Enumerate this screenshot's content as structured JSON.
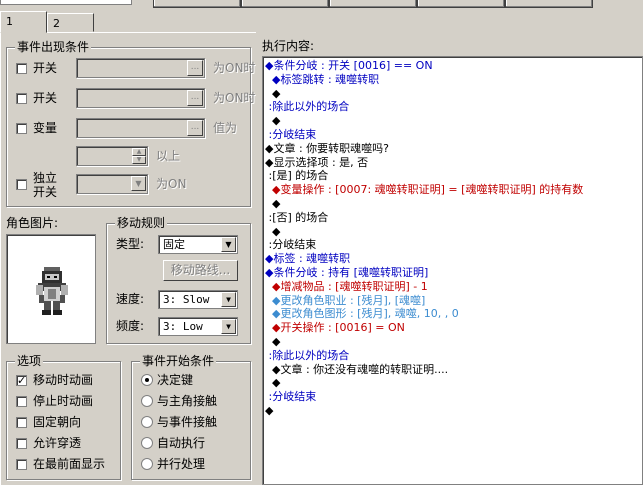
{
  "tabs": [
    "1",
    "2"
  ],
  "conditions": {
    "title": "事件出现条件",
    "switch1": {
      "label": "开关",
      "suffix": "为ON时"
    },
    "switch2": {
      "label": "开关",
      "suffix": "为ON时"
    },
    "variable": {
      "label": "变量",
      "suffix": "值为",
      "suffix2": "以上"
    },
    "self_switch": {
      "label_line1": "独立",
      "label_line2": "开关",
      "suffix": "为ON"
    }
  },
  "graphic": {
    "title": "角色图片:"
  },
  "movement": {
    "title": "移动规则",
    "type_label": "类型:",
    "type_value": "固定",
    "route_button": "移动路线...",
    "speed_label": "速度:",
    "speed_value": "3: Slow",
    "freq_label": "频度:",
    "freq_value": "3: Low"
  },
  "options": {
    "title": "选项",
    "items": [
      {
        "label": "移动时动画",
        "checked": true
      },
      {
        "label": "停止时动画",
        "checked": false
      },
      {
        "label": "固定朝向",
        "checked": false
      },
      {
        "label": "允许穿透",
        "checked": false
      },
      {
        "label": "在最前面显示",
        "checked": false
      }
    ]
  },
  "trigger": {
    "title": "事件开始条件",
    "items": [
      {
        "label": "决定键",
        "selected": true
      },
      {
        "label": "与主角接触",
        "selected": false
      },
      {
        "label": "与事件接触",
        "selected": false
      },
      {
        "label": "自动执行",
        "selected": false
      },
      {
        "label": "并行处理",
        "selected": false
      }
    ]
  },
  "contents": {
    "title": "执行内容:",
    "lines": [
      {
        "indent": "",
        "text": "◆条件分岐 : 开关 [0016] == ON",
        "color": "#0000c0"
      },
      {
        "indent": "  ",
        "text": "◆标签跳转 : 魂噬转职",
        "color": "#0000c0"
      },
      {
        "indent": "  ",
        "text": "◆",
        "color": "#000000"
      },
      {
        "indent": " ",
        "text": ":除此以外的场合",
        "color": "#0000c0"
      },
      {
        "indent": "  ",
        "text": "◆",
        "color": "#000000"
      },
      {
        "indent": " ",
        "text": ":分岐结束",
        "color": "#0000c0"
      },
      {
        "indent": "",
        "text": "◆文章 : 你要转职魂噬吗?",
        "color": "#000000"
      },
      {
        "indent": "",
        "text": "◆显示选择项 : 是, 否",
        "color": "#000000"
      },
      {
        "indent": " ",
        "text": ":[是] 的场合",
        "color": "#000000"
      },
      {
        "indent": "  ",
        "text": "◆变量操作 : [0007: 魂噬转职证明] = [魂噬转职证明] 的持有数",
        "color": "#c00000"
      },
      {
        "indent": "  ",
        "text": "◆",
        "color": "#000000"
      },
      {
        "indent": " ",
        "text": ":[否] 的场合",
        "color": "#000000"
      },
      {
        "indent": "  ",
        "text": "◆",
        "color": "#000000"
      },
      {
        "indent": " ",
        "text": ":分岐结束",
        "color": "#000000"
      },
      {
        "indent": "",
        "text": "◆标签 : 魂噬转职",
        "color": "#0000c0"
      },
      {
        "indent": "",
        "text": "◆条件分岐 : 持有 [魂噬转职证明]",
        "color": "#0000c0"
      },
      {
        "indent": "  ",
        "text": "◆增减物品 : [魂噬转职证明] - 1",
        "color": "#c00000"
      },
      {
        "indent": "  ",
        "text": "◆更改角色职业 : [残月], [魂噬]",
        "color": "#3c8cd0"
      },
      {
        "indent": "  ",
        "text": "◆更改角色图形 : [残月], 魂噬, 10, , 0",
        "color": "#3c8cd0"
      },
      {
        "indent": "  ",
        "text": "◆开关操作 : [0016] = ON",
        "color": "#c00000"
      },
      {
        "indent": "  ",
        "text": "◆",
        "color": "#000000"
      },
      {
        "indent": " ",
        "text": ":除此以外的场合",
        "color": "#0000c0"
      },
      {
        "indent": "  ",
        "text": "◆文章 : 你还没有魂噬的转职证明....",
        "color": "#000000"
      },
      {
        "indent": "  ",
        "text": "◆",
        "color": "#000000"
      },
      {
        "indent": " ",
        "text": ":分岐结束",
        "color": "#0000c0"
      },
      {
        "indent": "",
        "text": "◆",
        "color": "#000000"
      }
    ]
  }
}
